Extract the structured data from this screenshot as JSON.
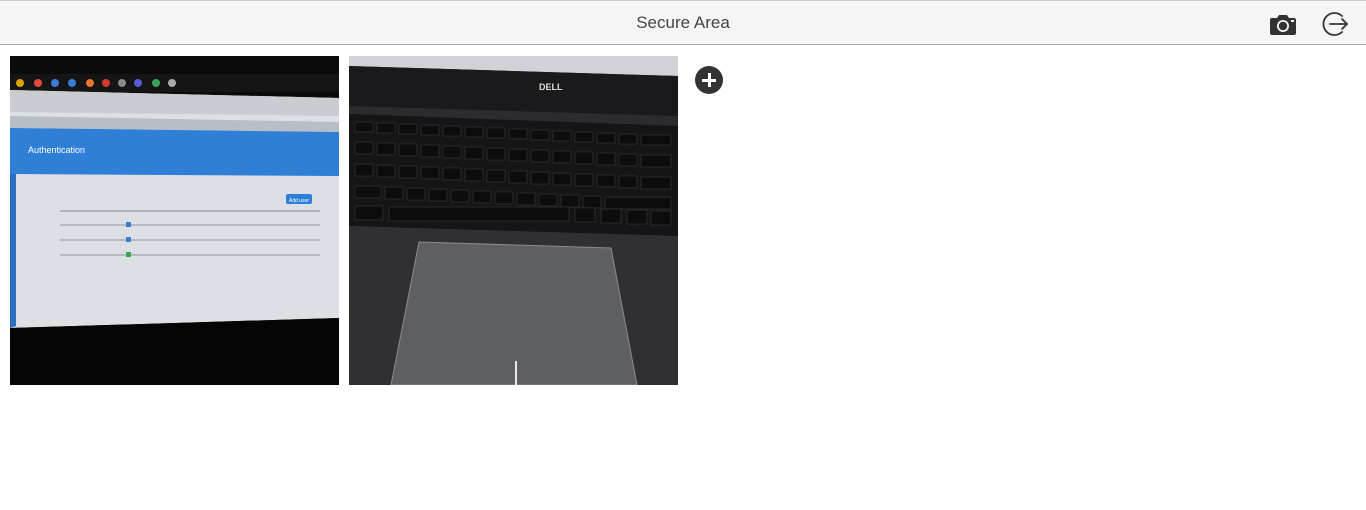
{
  "header": {
    "title": "Secure Area",
    "camera_icon": "camera-icon",
    "logout_icon": "logout-icon"
  },
  "gallery": {
    "photos": [
      {
        "alt": "Photo of a laptop screen showing Authentication page",
        "screen_heading": "Authentication",
        "screen_button": "Add user"
      },
      {
        "alt": "Photo of a Dell laptop keyboard and touchpad",
        "brand_mark": "DELL"
      }
    ],
    "add_icon": "add-circle-icon"
  },
  "colors": {
    "header_bg": "#f5f5f5",
    "title_text": "#444444",
    "icon": "#333333",
    "screen_blue": "#2f7fd6"
  }
}
